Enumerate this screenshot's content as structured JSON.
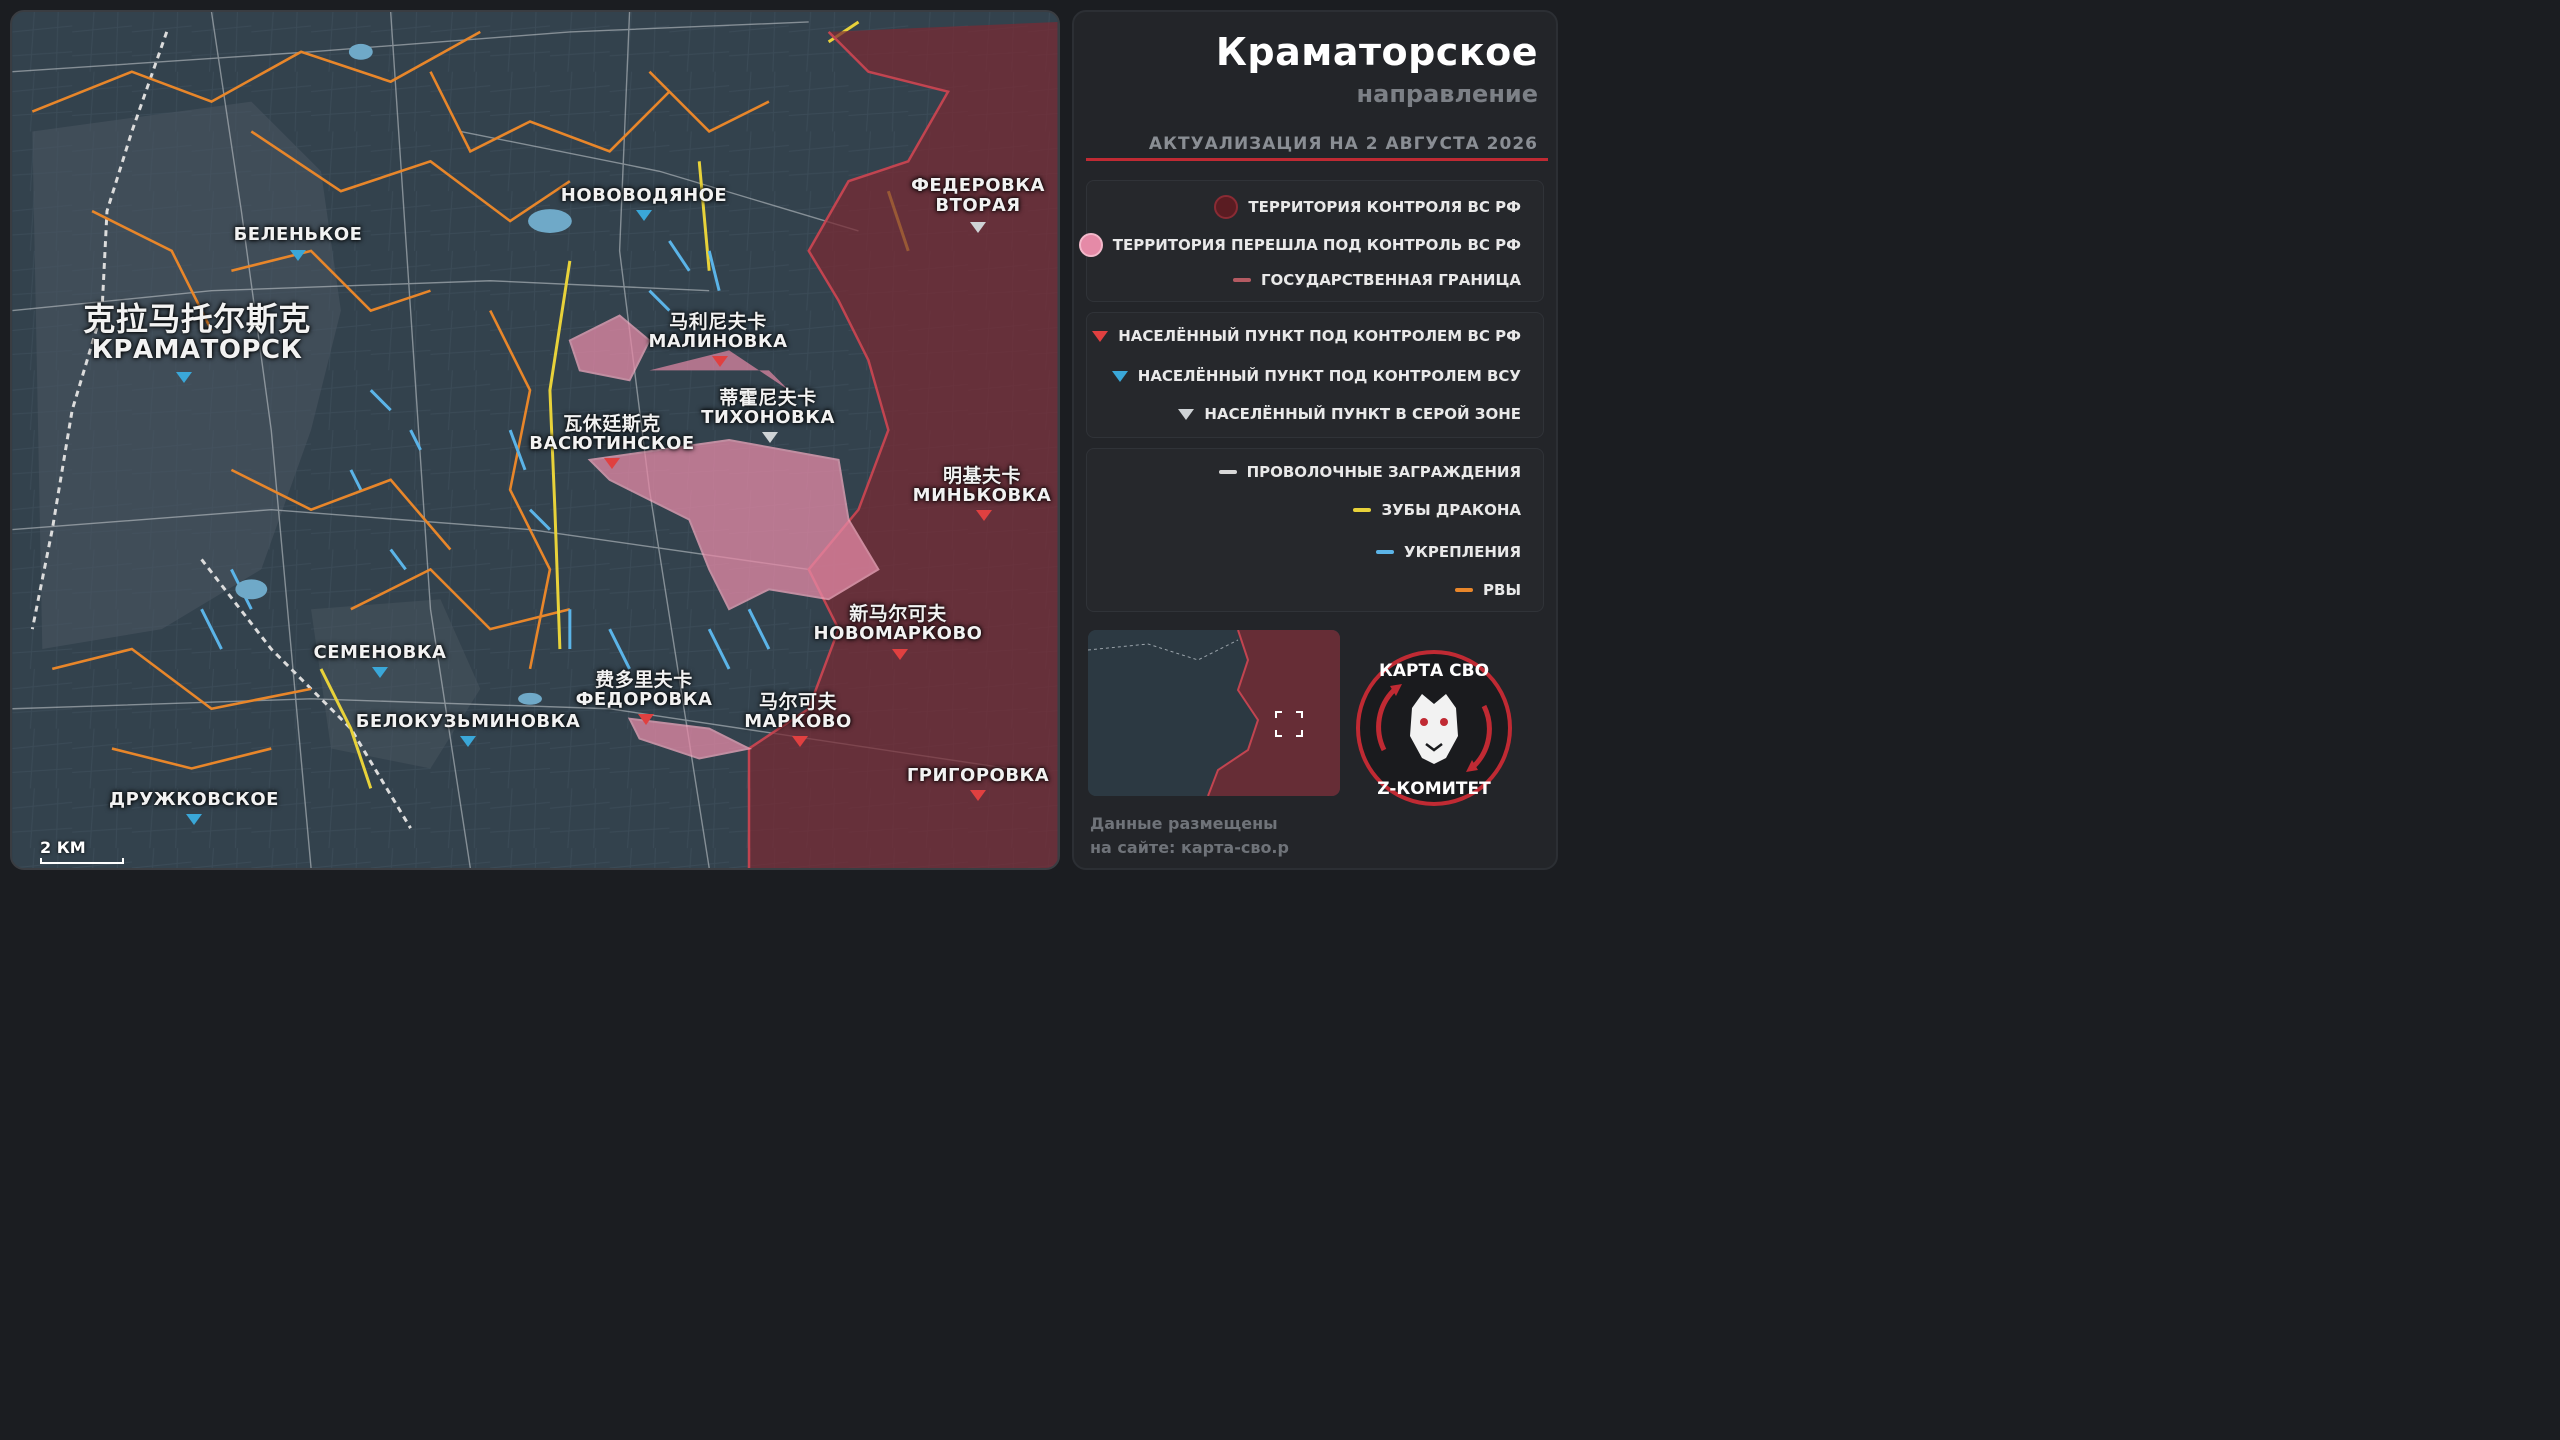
{
  "map": {
    "scale_label": "2 КМ",
    "settlements": [
      {
        "id": "kramatorsk",
        "cn": "克拉马托尔斯克",
        "ru": "КРАМАТОРСК",
        "status": "vsu",
        "big": true
      },
      {
        "id": "belenkoe",
        "cn": "",
        "ru": "БЕЛЕНЬКОЕ",
        "status": "vsu"
      },
      {
        "id": "novovodyanoe",
        "cn": "",
        "ru": "НОВОВОДЯНОЕ",
        "status": "vsu"
      },
      {
        "id": "fedorovka2",
        "cn": "",
        "ru": "ФЕДЕРОВКА ВТОРАЯ",
        "status": "grey"
      },
      {
        "id": "malinovka",
        "cn": "马利尼夫卡",
        "ru": "МАЛИНОВКА",
        "status": "rf"
      },
      {
        "id": "tikhonovka",
        "cn": "蒂霍尼夫卡",
        "ru": "ТИХОНОВКА",
        "status": "grey"
      },
      {
        "id": "vasyutinskoe",
        "cn": "瓦休廷斯克",
        "ru": "ВАСЮТИНСКОЕ",
        "status": "rf"
      },
      {
        "id": "minkovka",
        "cn": "明基夫卡",
        "ru": "МИНЬКОВКА",
        "status": "rf"
      },
      {
        "id": "novomarkovo",
        "cn": "新马尔可夫",
        "ru": "НОВОМАРКОВО",
        "status": "rf"
      },
      {
        "id": "semenovka",
        "cn": "",
        "ru": "СЕМЕНОВКА",
        "status": "vsu"
      },
      {
        "id": "fedorovka",
        "cn": "费多里夫卡",
        "ru": "ФЕДОРОВКА",
        "status": "rf"
      },
      {
        "id": "markovo",
        "cn": "马尔可夫",
        "ru": "МАРКОВО",
        "status": "rf"
      },
      {
        "id": "belokuzminovka",
        "cn": "",
        "ru": "БЕЛОКУЗЬМИНОВКА",
        "status": "vsu"
      },
      {
        "id": "grigorovka",
        "cn": "",
        "ru": "ГРИГОРОВКА",
        "status": "rf"
      },
      {
        "id": "druzhkovskoe",
        "cn": "",
        "ru": "ДРУЖКОВСКОЕ",
        "status": "vsu"
      }
    ]
  },
  "panel": {
    "title": "Краматорское",
    "subtitle": "направление",
    "update": "АКТУАЛИЗАЦИЯ НА 2 АВГУСТА 2026",
    "legend_territory": [
      {
        "label": "ТЕРРИТОРИЯ КОНТРОЛЯ ВС РФ",
        "color": "#5a1c22"
      },
      {
        "label": "ТЕРРИТОРИЯ ПЕРЕШЛА ПОД КОНТРОЛЬ ВС РФ",
        "color": "#e58aa7"
      },
      {
        "label": "ГОСУДАРСТВЕННАЯ ГРАНИЦА",
        "color": "#b45a62"
      }
    ],
    "legend_settlements": [
      {
        "label": "НАСЕЛЁННЫЙ ПУНКТ ПОД КОНТРОЛЕМ ВС РФ",
        "color": "#e04040"
      },
      {
        "label": "НАСЕЛЁННЫЙ ПУНКТ ПОД КОНТРОЛЕМ ВСУ",
        "color": "#3aa7d8"
      },
      {
        "label": "НАСЕЛЁННЫЙ ПУНКТ В СЕРОЙ ЗОНЕ",
        "color": "#cfd3d6"
      }
    ],
    "legend_lines": [
      {
        "label": "ПРОВОЛОЧНЫЕ ЗАГРАЖДЕНИЯ",
        "color": "#d8d8d8"
      },
      {
        "label": "ЗУБЫ ДРАКОНА",
        "color": "#e8d23a"
      },
      {
        "label": "УКРЕПЛЕНИЯ",
        "color": "#5bb4e8"
      },
      {
        "label": "РВЫ",
        "color": "#e8862a"
      }
    ],
    "logo_top": "КАРТА СВО",
    "logo_bottom": "Z-КОМИТЕТ",
    "footer_line1": "Данные размещены",
    "footer_line2": "на сайте: карта-сво.р"
  },
  "colors": {
    "rf_zone": "#7a2a33",
    "new_zone": "#e58aa7",
    "accent": "#c02a33"
  }
}
